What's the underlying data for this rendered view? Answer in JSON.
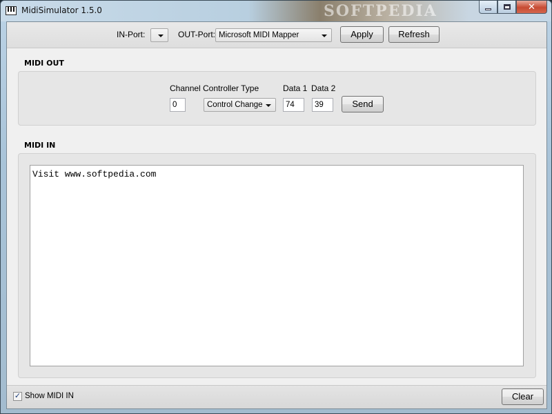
{
  "window": {
    "title": "MidiSimulator 1.5.0",
    "icon": "piano-keys-icon",
    "watermark": "SOFTPEDIA",
    "controls": {
      "minimize": "minimize-icon",
      "maximize": "maximize-icon",
      "close": "✕"
    }
  },
  "toolbar": {
    "in_port_label": "IN-Port:",
    "in_port_value": "",
    "out_port_label": "OUT-Port:",
    "out_port_value": "Microsoft MIDI Mapper",
    "apply_label": "Apply",
    "refresh_label": "Refresh"
  },
  "midi_out": {
    "title": "MIDI OUT",
    "channel_label": "Channel",
    "channel_value": "0",
    "controller_type_label": "Controller Type",
    "controller_type_value": "Control Change",
    "data1_label": "Data 1",
    "data1_value": "74",
    "data2_label": "Data 2",
    "data2_value": "39",
    "send_label": "Send"
  },
  "midi_in": {
    "title": "MIDI IN",
    "log_text": "Visit www.softpedia.com"
  },
  "footer": {
    "show_midi_in_label": "Show MIDI IN",
    "show_midi_in_checked": true,
    "clear_label": "Clear"
  },
  "colors": {
    "window_bg": "#f0f0f0",
    "groupbox_bg": "#e6e6e6",
    "close_button": "#c74a32"
  }
}
